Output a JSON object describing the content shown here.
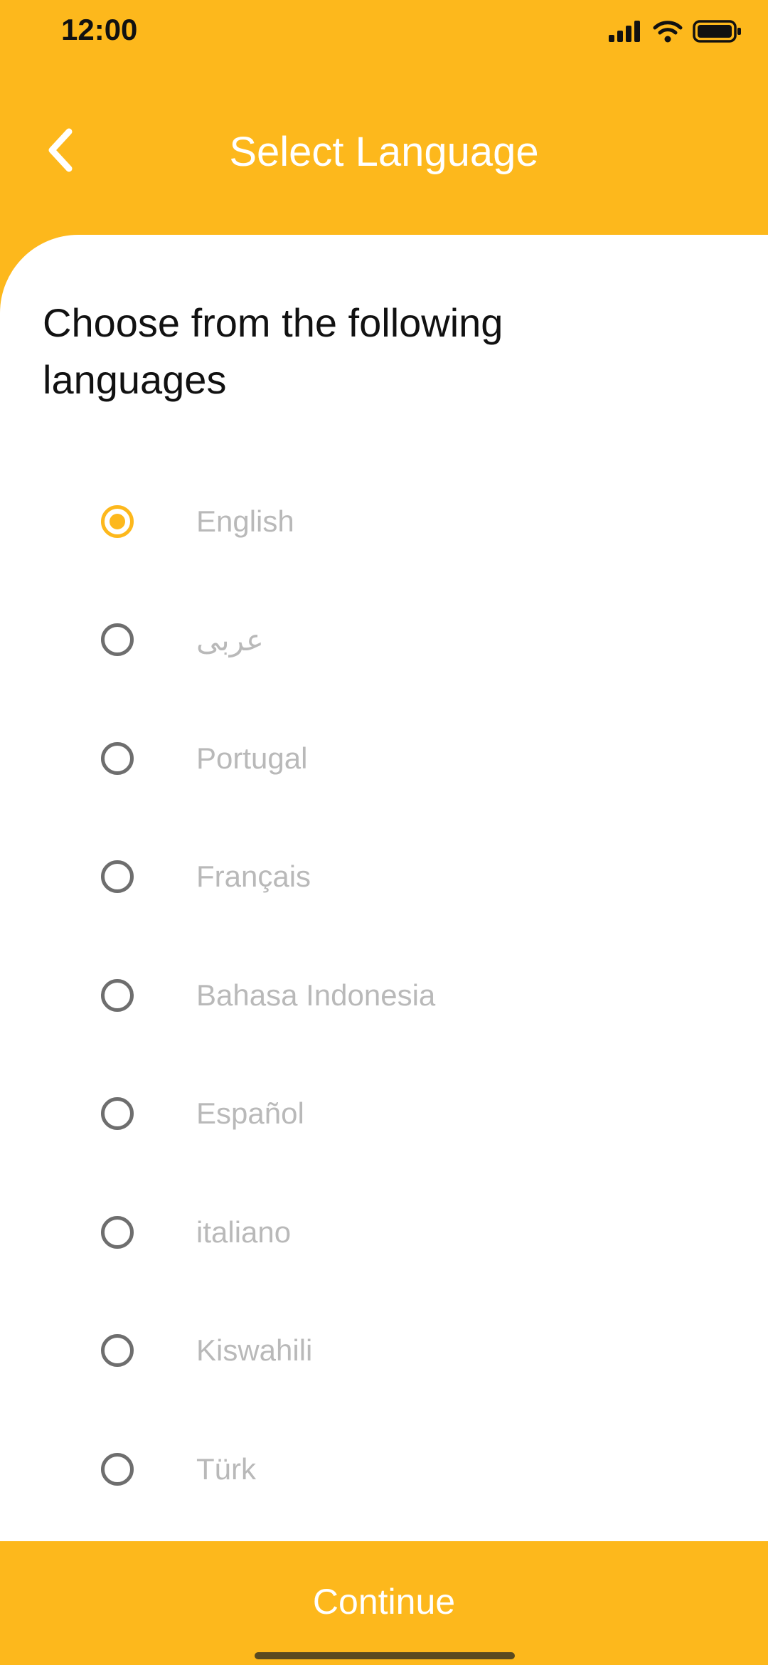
{
  "status_bar": {
    "time": "12:00",
    "icons": [
      "signal-icon",
      "wifi-icon",
      "battery-icon"
    ]
  },
  "header": {
    "title": "Select Language",
    "back_icon": "chevron-left-icon"
  },
  "content": {
    "title": "Choose from the following languages",
    "selected_index": 0,
    "languages": [
      {
        "label": "English"
      },
      {
        "label": "عربى"
      },
      {
        "label": "Portugal"
      },
      {
        "label": "Français"
      },
      {
        "label": "Bahasa Indonesia"
      },
      {
        "label": "Español"
      },
      {
        "label": "italiano"
      },
      {
        "label": "Kiswahili"
      },
      {
        "label": "Türk"
      }
    ]
  },
  "footer": {
    "continue_label": "Continue"
  },
  "colors": {
    "accent": "#FDB81C",
    "text_primary": "#111111",
    "text_muted": "#B9B9B9",
    "radio_unselected": "#6E6E6E",
    "panel_bg": "#FFFFFF"
  }
}
